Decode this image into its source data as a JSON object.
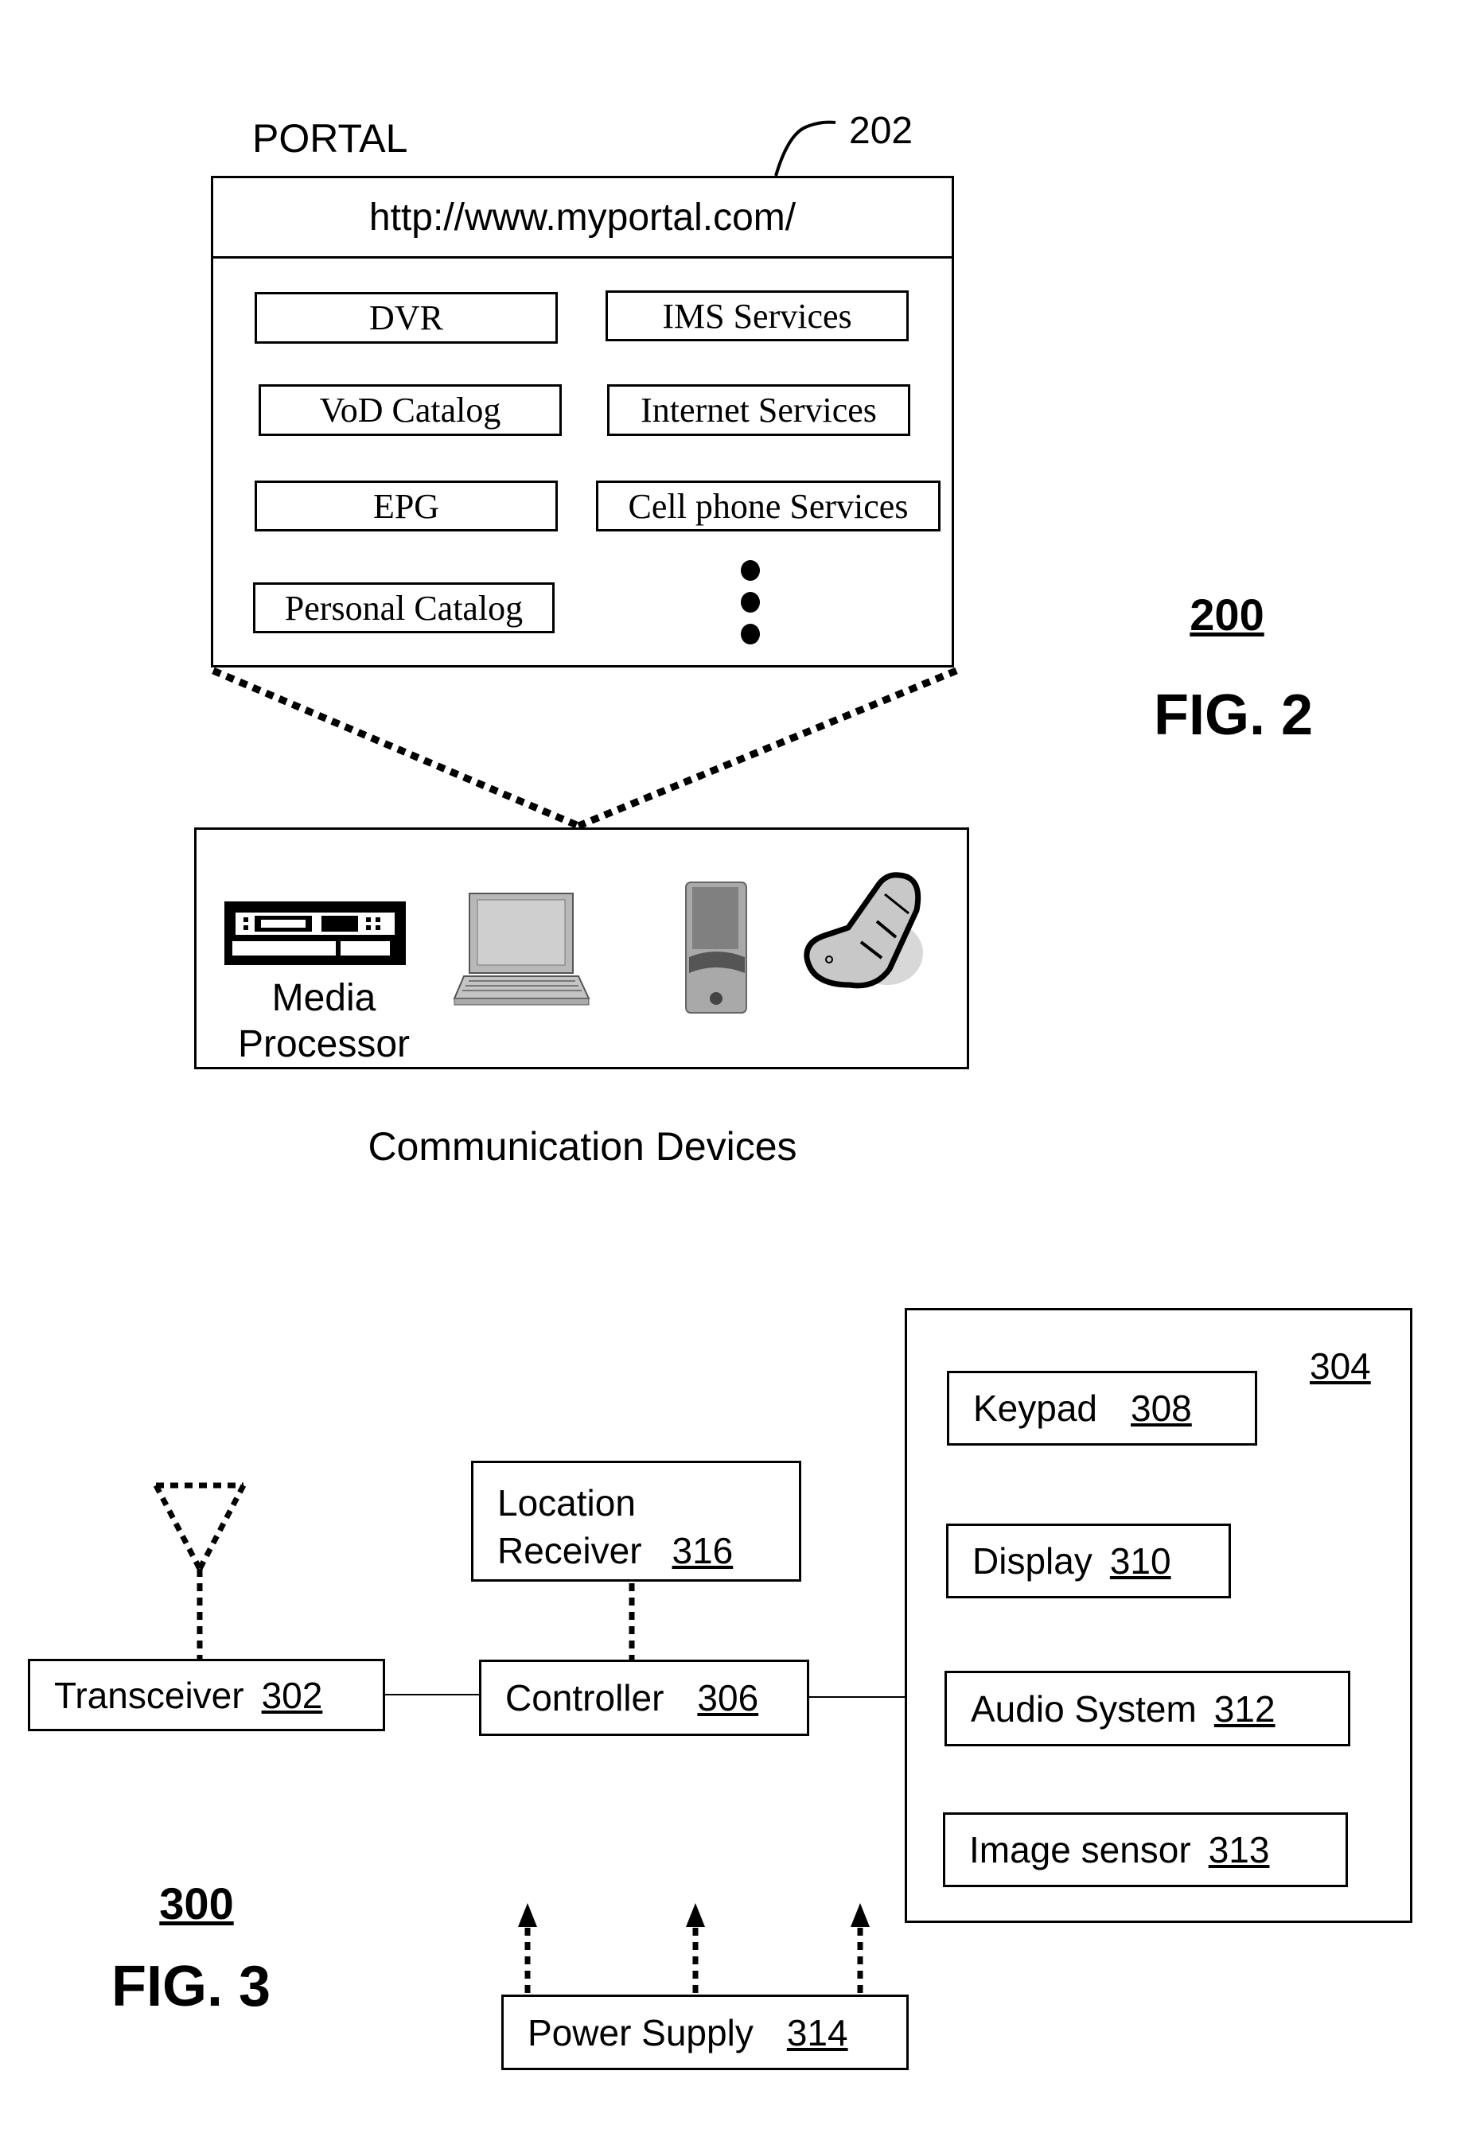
{
  "fig2": {
    "portal_label": "PORTAL",
    "portal_ref": "202",
    "url": "http://www.myportal.com/",
    "services": [
      {
        "label": "DVR"
      },
      {
        "label": "IMS Services"
      },
      {
        "label": "VoD Catalog"
      },
      {
        "label": "Internet Services"
      },
      {
        "label": "EPG"
      },
      {
        "label": "Cell phone Services"
      },
      {
        "label": "Personal Catalog"
      }
    ],
    "ellipsis_icon": "vertical-ellipsis",
    "devices": {
      "media_processor_line1": "Media",
      "media_processor_line2": "Processor",
      "icons": [
        "set-top-box-icon",
        "laptop-icon",
        "pda-phone-icon",
        "flip-phone-icon"
      ],
      "caption": "Communication Devices"
    },
    "ref_number": "200",
    "fig_label": "FIG. 2"
  },
  "fig3": {
    "transceiver": {
      "label": "Transceiver",
      "num": "302"
    },
    "controller": {
      "label": "Controller",
      "num": "306"
    },
    "location_receiver": {
      "label_line1": "Location",
      "label_line2": "Receiver",
      "num": "316"
    },
    "ui_group_ref": "304",
    "keypad": {
      "label": "Keypad",
      "num": "308"
    },
    "display": {
      "label": "Display",
      "num": "310"
    },
    "audio": {
      "label": "Audio System",
      "num": "312"
    },
    "image_sensor": {
      "label": "Image sensor",
      "num": "313"
    },
    "power_supply": {
      "label": "Power Supply",
      "num": "314"
    },
    "ref_number": "300",
    "fig_label": "FIG. 3"
  }
}
